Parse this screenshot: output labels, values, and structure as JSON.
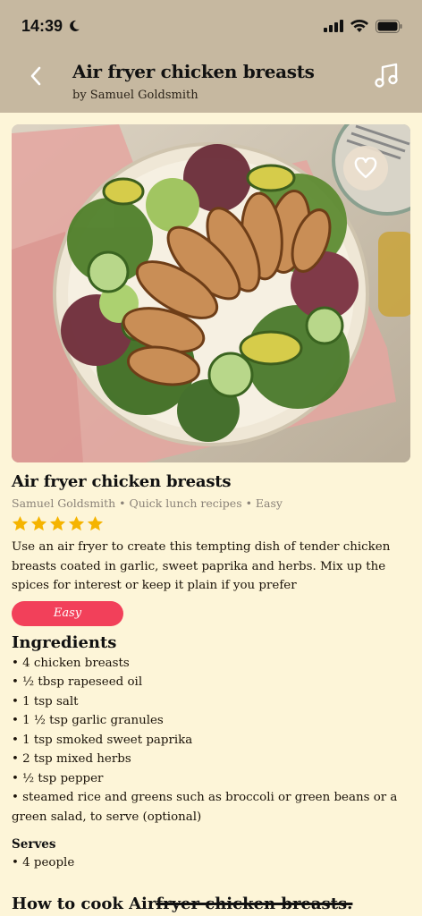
{
  "status": {
    "time": "14:39"
  },
  "header": {
    "title": "Air fryer chicken breasts",
    "subtitle": "by Samuel Goldsmith"
  },
  "recipe": {
    "title": "Air fryer chicken breasts",
    "meta": "Samuel Goldsmith • Quick lunch recipes • Easy",
    "rating": 5,
    "rating_max": 5,
    "description": "Use an air fryer to create this tempting dish of tender chicken breasts coated in garlic, sweet paprika and herbs. Mix up the spices for interest or keep it plain if you prefer",
    "difficulty": "Easy"
  },
  "ingredients": {
    "title": "Ingredients",
    "items": [
      "• 4 chicken breasts",
      "• ½ tbsp  rapeseed oil",
      "• 1 tsp  salt",
      "• 1 ½ tsp  garlic granules",
      "• 1 tsp  smoked sweet paprika",
      "• 2 tsp  mixed herbs",
      "• ½ tsp  pepper",
      "• steamed rice  and greens such as broccoli or green beans or a green salad, to serve (optional)"
    ]
  },
  "serves": {
    "title": "Serves",
    "value": "• 4 people"
  },
  "how_to": {
    "prefix": "How to cook Air",
    "suffix": "fryer chicken breasts."
  },
  "colors": {
    "header_bg": "#c6b8a0",
    "page_bg": "#fdf5d8",
    "accent": "#f2405a",
    "star": "#f5b400"
  }
}
